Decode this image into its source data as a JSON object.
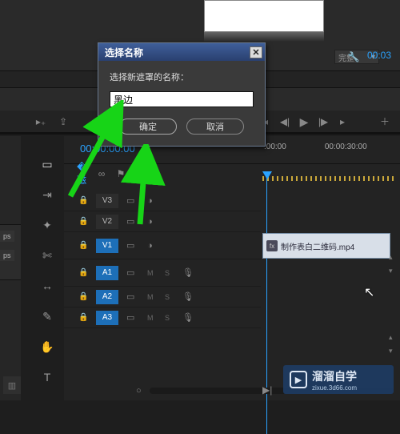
{
  "top": {
    "effects_dropdown": "完整",
    "timecode": "00:03"
  },
  "dialog": {
    "title": "选择名称",
    "label": "选择新遮罩的名称：",
    "input_value": "黑边",
    "ok": "确定",
    "cancel": "取消"
  },
  "timeline": {
    "head_time": "00:00:00:00",
    "ruler": {
      "t0": ":00:00",
      "t1": "00:00:30:00"
    },
    "tracks": {
      "v3": "V3",
      "v2": "V2",
      "v1": "V1",
      "a1": "A1",
      "a2": "A2",
      "a3": "A3",
      "m": "M",
      "s": "S"
    },
    "clip": {
      "name": "制作表白二维码.mp4"
    }
  },
  "proj": {
    "tag1": "ps",
    "tag2": "ps"
  },
  "watermark": {
    "brand": "溜溜自学",
    "url": "zixue.3d66.com"
  }
}
